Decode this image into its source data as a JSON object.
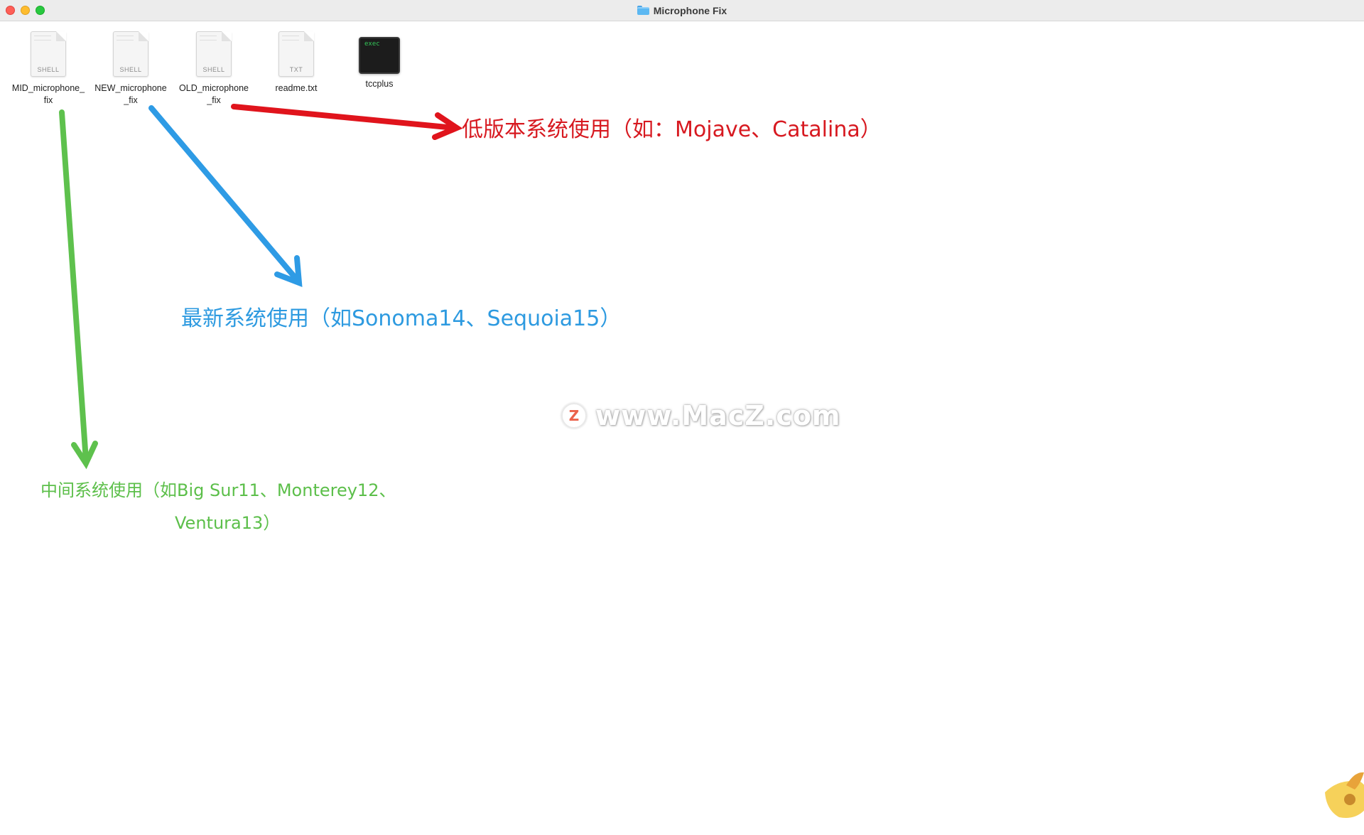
{
  "window": {
    "title": "Microphone Fix",
    "icon": "folder-icon"
  },
  "files": [
    {
      "name_line1": "MID_microphone_",
      "name_line2": "fix",
      "kind": "SHELL",
      "icon": "shell-script-icon"
    },
    {
      "name_line1": "NEW_microphone",
      "name_line2": "_fix",
      "kind": "SHELL",
      "icon": "shell-script-icon"
    },
    {
      "name_line1": "OLD_microphone",
      "name_line2": "_fix",
      "kind": "SHELL",
      "icon": "shell-script-icon"
    },
    {
      "name_line1": "readme.txt",
      "name_line2": "",
      "kind": "TXT",
      "icon": "text-document-icon"
    },
    {
      "name_line1": "tccplus",
      "name_line2": "",
      "kind": "exec",
      "icon": "unix-executable-icon"
    }
  ],
  "annotations": {
    "old": {
      "text": "低版本系统使用（如：Mojave、Catalina）",
      "color": "#d71920"
    },
    "new": {
      "text": "最新系统使用（如Sonoma14、Sequoia15）",
      "color": "#2d9ae0"
    },
    "mid": {
      "line1": "中间系统使用（如Big Sur11、Monterey12、",
      "line2": "Ventura13）",
      "color": "#5cbf4a"
    }
  },
  "watermark": {
    "logo_letter": "Z",
    "text": "www.MacZ.com"
  }
}
